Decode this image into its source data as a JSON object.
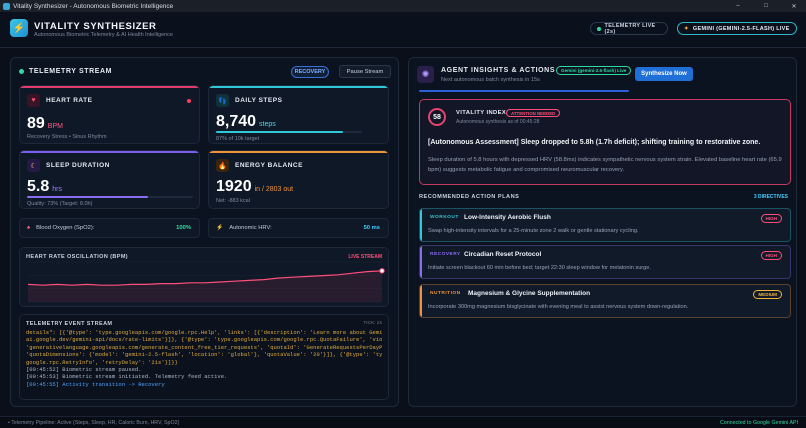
{
  "window": {
    "title": "Vitality Synthesizer - Autonomous Biometric Intelligence",
    "minimize": "–",
    "maximize": "□",
    "close": "✕"
  },
  "header": {
    "title": "VITALITY SYNTHESIZER",
    "subtitle": "Autonomous Biometric Telemetry & AI Health Intelligence",
    "telemetry_pill": "TELEMETRY LIVE (2s)",
    "model_pill": "GEMINI (GEMINI-2.5-FLASH) LIVE"
  },
  "telemetry": {
    "title": "TELEMETRY STREAM",
    "recovery_button": "RECOVERY",
    "pause_button": "Pause Stream",
    "heart_rate": {
      "title": "HEART RATE",
      "value": "89",
      "unit": "BPM",
      "sub": "Recovery Stress • Sinus Rhythm"
    },
    "daily_steps": {
      "title": "DAILY STEPS",
      "value": "8,740",
      "unit": "steps",
      "sub": "87% of 10k target",
      "progress": 0.87
    },
    "sleep": {
      "title": "SLEEP DURATION",
      "value": "5.8",
      "unit": "hrs",
      "sub": "Quality: 73% (Target: 8.0h)",
      "progress": 0.73
    },
    "energy": {
      "title": "ENERGY BALANCE",
      "value": "1920",
      "unit": "in / 2803 out",
      "sub": "Net: -883 kcal"
    },
    "spo2": {
      "label": "Blood Oxygen (SpO2):",
      "value": "100%"
    },
    "hrv": {
      "label": "Autonomic HRV:",
      "value": "50 ms"
    }
  },
  "hr_chart": {
    "title": "HEART RATE OSCILLATION (BPM)",
    "badge": "LIVE STREAM"
  },
  "chart_data": {
    "type": "area",
    "title": "HEART RATE OSCILLATION (BPM)",
    "x": [
      1,
      2,
      3,
      4,
      5,
      6,
      7,
      8,
      9,
      10,
      11,
      12,
      13,
      14,
      15,
      16,
      17,
      18,
      19,
      20,
      21,
      22,
      23,
      24,
      25
    ],
    "series": [
      {
        "values": [
          72,
          71,
          72,
          71,
          72,
          71,
          71,
          72,
          72,
          73,
          73,
          74,
          74,
          75,
          76,
          77,
          78,
          80,
          81,
          82,
          83,
          84,
          86,
          88,
          89
        ]
      }
    ],
    "ylim": [
      50,
      100
    ],
    "grid": true
  },
  "event_stream": {
    "title": "TELEMETRY EVENT STREAM",
    "tick": "TICK: 2s",
    "lines": [
      {
        "text": "details\": [{'@type': 'type.googleapis.com/google.rpc.Help', 'links': [{'description': 'Learn more about Gemini API quotas', 'url': 'https://",
        "color": "#e0a93b"
      },
      {
        "text": "ai.google.dev/gemini-api/docs/rate-limits'}]}, {'@type': 'type.googleapis.com/google.rpc.QuotaFailure', 'violations': [{'quotaMetric':",
        "color": "#e0a93b"
      },
      {
        "text": "'generativelanguage.googleapis.com/generate_content_free_tier_requests', 'quotaId': 'GenerateRequestsPerDayPerProjectPerModel-FreeTier',",
        "color": "#e0a93b"
      },
      {
        "text": "'quotaDimensions': {'model': 'gemini-2.5-flash', 'location': 'global'}, 'quotaValue': '20'}]}, {'@type': 'type.googleapis.com/",
        "color": "#e0a93b"
      },
      {
        "text": "google.rpc.RetryInfo', 'retryDelay': '21s'}]}}",
        "color": "#e0a93b"
      },
      {
        "text": "[00:45:52] Biometric stream paused.",
        "color": "#aeb7c6"
      },
      {
        "text": "[00:45:53] Biometric stream initiated. Telemetry feed active.",
        "color": "#aeb7c6"
      },
      {
        "text": "[00:45:55] Activity transition -> Recovery",
        "color": "#4aa3ff"
      }
    ]
  },
  "agent": {
    "title": "AGENT INSIGHTS & ACTIONS",
    "model_badge": "Gemini (gemini-2.5-flash) Live",
    "next": "Next autonomous batch synthesis in 15s",
    "synthesize_button": "Synthesize Now"
  },
  "vitality": {
    "score": "58",
    "label": "VITALITY INDEX",
    "badge": "ATTENTION NEEDED",
    "timestamp": "Autonomous synthesis as of 00:45:28",
    "headline": "[Autonomous Assessment] Sleep dropped to 5.8h (1.7h deficit); shifting training to restorative zone.",
    "body": "Sleep duration of 5.8 hours with depressed HRV (58.8ms) indicates sympathetic nervous system strain. Elevated baseline heart rate (65.9 bpm) suggests metabolic fatigue and compromised neuromuscular recovery."
  },
  "plans": {
    "title": "RECOMMENDED ACTION PLANS",
    "count": "3 DIRECTIVES",
    "items": [
      {
        "tag": "WORKOUT",
        "title": "Low-Intensity Aerobic Flush",
        "desc": "Swap high-intensity intervals for a 25-minute zone 2 walk or gentle stationary cycling.",
        "priority": "HIGH",
        "color": "#2fc8d8",
        "pcolor": "#ff4f78"
      },
      {
        "tag": "RECOVERY",
        "title": "Circadian Reset Protocol",
        "desc": "Initiate screen blackout 60 min before bed; target 22:30 sleep window for melatonin surge.",
        "priority": "HIGH",
        "color": "#8b6cf0",
        "pcolor": "#ff4f78"
      },
      {
        "tag": "NUTRITION",
        "title": "Magnesium & Glycine Supplementation",
        "desc": "Incorporate 300mg magnesium bisglycinate with evening meal to assist nervous system down-regulation.",
        "priority": "MEDIUM",
        "color": "#f0923a",
        "pcolor": "#f0b43a"
      }
    ]
  },
  "footer": {
    "left": "• Telemetry Pipeline: Active (Steps, Sleep, HR, Caloric Burn, HRV, SpO2)",
    "right": "Connected to Google Gemini API"
  }
}
